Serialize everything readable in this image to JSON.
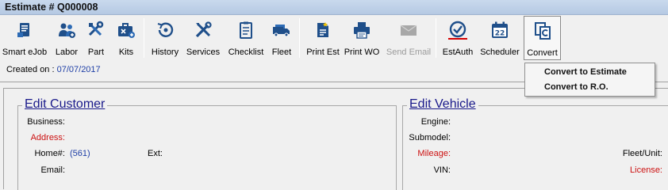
{
  "window": {
    "title": "Estimate # Q000008"
  },
  "toolbar": {
    "buttons": [
      {
        "label": "Smart eJob",
        "icon": "smart-ejob-icon"
      },
      {
        "label": "Labor",
        "icon": "labor-icon"
      },
      {
        "label": "Part",
        "icon": "part-icon"
      },
      {
        "label": "Kits",
        "icon": "kits-icon"
      },
      {
        "label": "History",
        "icon": "history-icon"
      },
      {
        "label": "Services",
        "icon": "services-icon"
      },
      {
        "label": "Checklist",
        "icon": "checklist-icon"
      },
      {
        "label": "Fleet",
        "icon": "fleet-icon"
      },
      {
        "label": "Print Est",
        "icon": "print-estimate-icon"
      },
      {
        "label": "Print WO",
        "icon": "print-wo-icon"
      },
      {
        "label": "Send Email",
        "icon": "send-email-icon",
        "disabled": true
      },
      {
        "label": "EstAuth",
        "icon": "estauth-icon"
      },
      {
        "label": "Scheduler",
        "icon": "scheduler-icon"
      },
      {
        "label": "Convert",
        "icon": "convert-icon",
        "pressed": true
      }
    ]
  },
  "created": {
    "label": "Created on :",
    "value": "07/07/2017"
  },
  "convert_menu": {
    "items": [
      "Convert to Estimate",
      "Convert to R.O."
    ]
  },
  "customer": {
    "title": "Edit Customer",
    "business_label": "Business:",
    "address_label": "Address:",
    "home_label": "Home#:",
    "home_value": "(561)",
    "ext_label": "Ext:",
    "email_label": "Email:"
  },
  "vehicle": {
    "title": "Edit Vehicle",
    "engine_label": "Engine:",
    "submodel_label": "Submodel:",
    "mileage_label": "Mileage:",
    "vin_label": "VIN:",
    "fleet_unit_label": "Fleet/Unit:",
    "license_label": "License:"
  },
  "colors": {
    "required_label": "#cc1111",
    "value_blue": "#1f3fa6",
    "legend": "#18188a"
  }
}
